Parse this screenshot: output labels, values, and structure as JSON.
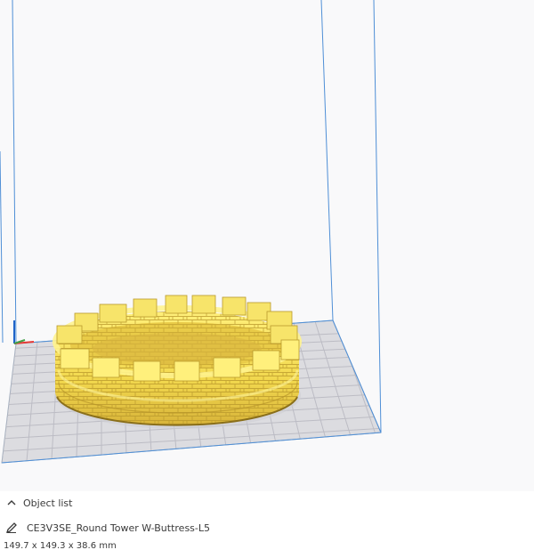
{
  "object_list": {
    "header_label": "Object list",
    "collapse_icon": "chevron-up-icon",
    "edit_icon": "pencil-icon",
    "object_name": "CE3V3SE_Round Tower W-Buttress-L5",
    "dimensions": "149.7 x 149.3 x 38.6 mm"
  },
  "colors": {
    "model": "#f5e15c",
    "model_shadow": "#c9a92e",
    "build_plate": "#d9d9dd",
    "grid_line": "#bfbfc5",
    "volume_edge": "#4f8fd6",
    "axis_x": "#e53935",
    "axis_y": "#43a047",
    "axis_z": "#1e63c9"
  }
}
